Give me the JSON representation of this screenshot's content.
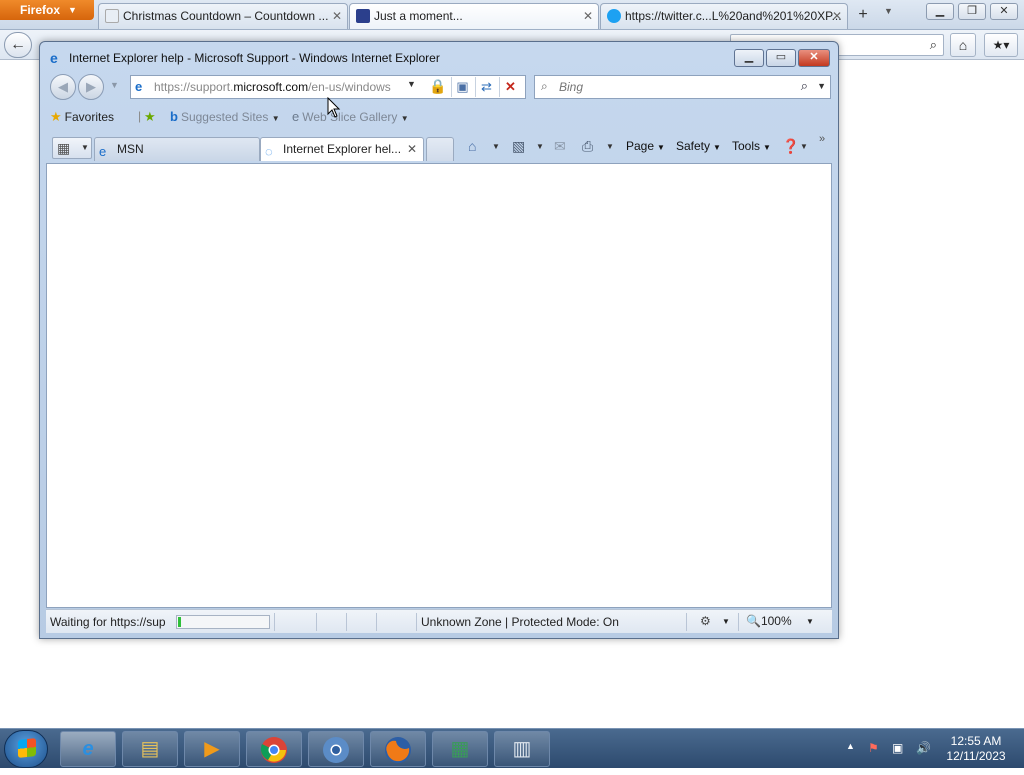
{
  "firefox": {
    "menu_label": "Firefox",
    "tabs": [
      {
        "title": "Christmas Countdown – Countdown ..."
      },
      {
        "title": "Just a moment..."
      },
      {
        "title": "https://twitter.c...L%20and%201%20XP..."
      }
    ]
  },
  "ie": {
    "window_title": "Internet Explorer help - Microsoft Support - Windows Internet Explorer",
    "address": {
      "prefix": "https://support.",
      "domain": "microsoft.com",
      "path": "/en-us/windows"
    },
    "search_placeholder": "Bing",
    "favorites": {
      "favorites_label": "Favorites",
      "suggested_sites": "Suggested Sites",
      "web_slice_gallery": "Web Slice Gallery"
    },
    "tabs": [
      {
        "title": "MSN"
      },
      {
        "title": "Internet Explorer hel..."
      }
    ],
    "commands": {
      "page": "Page",
      "safety": "Safety",
      "tools": "Tools"
    },
    "status": {
      "text": "Waiting for https://sup",
      "zone": "Unknown Zone | Protected Mode: On",
      "zoom": "100%",
      "progress": 0.03
    }
  },
  "taskbar": {
    "time": "12:55 AM",
    "date": "12/11/2023"
  }
}
